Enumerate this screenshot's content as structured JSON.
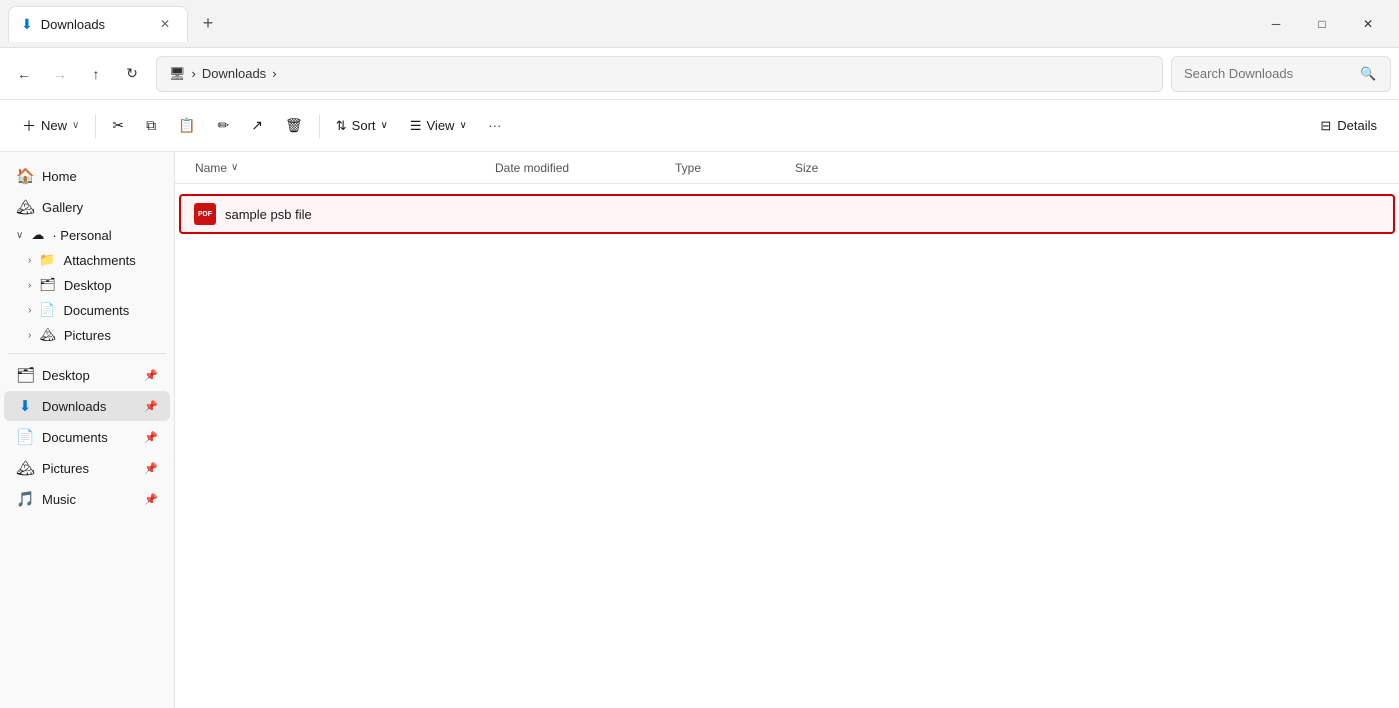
{
  "titlebar": {
    "tab_icon": "⬇",
    "tab_title": "Downloads",
    "tab_close": "✕",
    "new_tab": "+",
    "minimize": "─",
    "maximize": "□",
    "close": "✕"
  },
  "toolbar": {
    "back": "←",
    "forward": "→",
    "up": "↑",
    "refresh": "↻",
    "pc_icon": "🖥",
    "breadcrumb_sep1": "›",
    "location": "Downloads",
    "breadcrumb_sep2": "›",
    "search_placeholder": "Search Downloads",
    "search_icon": "🔍"
  },
  "commandbar": {
    "new_label": "New",
    "new_arrow": "∨",
    "cut_icon": "✂",
    "copy_icon": "⧉",
    "paste_icon": "📋",
    "rename_icon": "✏",
    "share_icon": "↗",
    "delete_icon": "🗑",
    "sort_label": "Sort",
    "sort_arrow": "∨",
    "view_label": "View",
    "view_arrow": "∨",
    "more_icon": "···",
    "details_label": "Details"
  },
  "sidebar": {
    "items": [
      {
        "id": "home",
        "icon": "🏠",
        "label": "Home",
        "pinned": false
      },
      {
        "id": "gallery",
        "icon": "🏔",
        "label": "Gallery",
        "pinned": false
      }
    ],
    "cloud_section": {
      "expanded": true,
      "cloud_icon": "☁",
      "label": "Personal",
      "children": [
        {
          "id": "attachments",
          "icon": "📁",
          "label": "Attachments",
          "has_arrow": true
        },
        {
          "id": "desktop-cloud",
          "icon": "🗂",
          "label": "Desktop",
          "has_arrow": true
        },
        {
          "id": "documents-cloud",
          "icon": "📄",
          "label": "Documents",
          "has_arrow": true
        },
        {
          "id": "pictures-cloud",
          "icon": "🏔",
          "label": "Pictures",
          "has_arrow": true
        }
      ]
    },
    "pinned_items": [
      {
        "id": "desktop",
        "icon": "🗂",
        "label": "Desktop",
        "pinned": true
      },
      {
        "id": "downloads",
        "icon": "⬇",
        "label": "Downloads",
        "pinned": true,
        "active": true
      },
      {
        "id": "documents",
        "icon": "📄",
        "label": "Documents",
        "pinned": true
      },
      {
        "id": "pictures",
        "icon": "🏔",
        "label": "Pictures",
        "pinned": true
      },
      {
        "id": "music",
        "icon": "🎵",
        "label": "Music",
        "pinned": true
      }
    ]
  },
  "content": {
    "columns": [
      {
        "id": "name",
        "label": "Name",
        "sort_icon": "∨"
      },
      {
        "id": "date",
        "label": "Date modified"
      },
      {
        "id": "type",
        "label": "Type"
      },
      {
        "id": "size",
        "label": "Size"
      }
    ],
    "files": [
      {
        "id": "sample-psb",
        "icon_type": "pdf",
        "icon_label": "PDF",
        "name": "sample psb file",
        "date": "",
        "type": "",
        "size": "",
        "selected": true
      }
    ]
  }
}
